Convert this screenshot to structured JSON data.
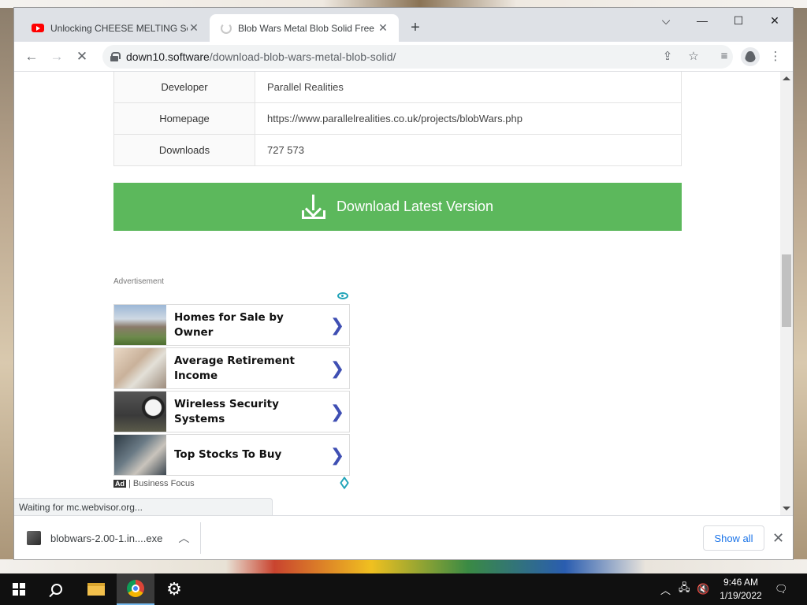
{
  "browser": {
    "tabs": [
      {
        "title": "Unlocking CHEESE MELTING Secr",
        "icon": "youtube-icon"
      },
      {
        "title": "Blob Wars Metal Blob Solid Free",
        "icon": "loading-spinner-icon"
      }
    ],
    "url": {
      "host": "down10.software",
      "path": "/download-blob-wars-metal-blob-solid/"
    }
  },
  "info_table": [
    {
      "key": "Developer",
      "value": "Parallel Realities"
    },
    {
      "key": "Homepage",
      "value": "https://www.parallelrealities.co.uk/projects/blobWars.php"
    },
    {
      "key": "Downloads",
      "value": "727 573"
    }
  ],
  "download_button": {
    "label": "Download Latest Version",
    "color": "#5cb85c"
  },
  "ad": {
    "label": "Advertisement",
    "items": [
      {
        "title": "Homes for Sale by Owner"
      },
      {
        "title": "Average Retirement Income"
      },
      {
        "title": "Wireless Security Systems"
      },
      {
        "title": "Top Stocks To Buy"
      }
    ],
    "badge": "Ad",
    "source": "Business Focus",
    "chevron_color": "#3f4fb3"
  },
  "status_text": "Waiting for mc.webvisor.org...",
  "download_shelf": {
    "filename": "blobwars-2.00-1.in....exe",
    "show_all": "Show all"
  },
  "taskbar": {
    "time": "9:46 AM",
    "date": "1/19/2022"
  }
}
